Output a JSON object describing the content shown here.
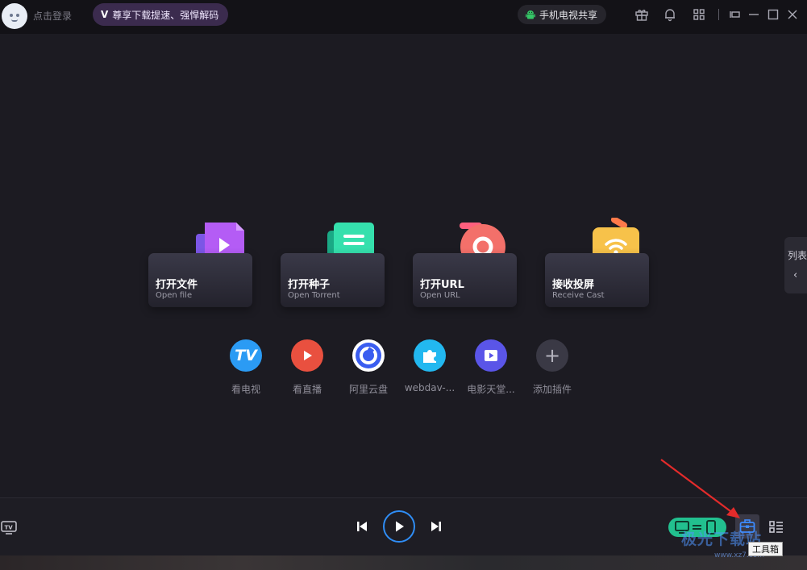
{
  "titlebar": {
    "login_label": "点击登录",
    "vip_label": "尊享下载提速、强悍解码",
    "share_label": "手机电视共享",
    "icons": [
      "gift-icon",
      "bell-icon",
      "apps-icon",
      "mini-mode-icon",
      "minimize-icon",
      "maximize-icon",
      "close-icon"
    ]
  },
  "cards": [
    {
      "title": "打开文件",
      "sub": "Open file",
      "color": "#a25cf3"
    },
    {
      "title": "打开种子",
      "sub": "Open Torrent",
      "color": "#2fd9a8"
    },
    {
      "title": "打开URL",
      "sub": "Open URL",
      "color": "#f36b6b"
    },
    {
      "title": "接收投屏",
      "sub": "Receive Cast",
      "color": "#f7c24a"
    }
  ],
  "plugins": [
    {
      "label": "看电视",
      "glyph": "TV",
      "color": "#2b9bf4"
    },
    {
      "label": "看直播",
      "glyph": "",
      "color": "#e9503f"
    },
    {
      "label": "阿里云盘",
      "glyph": "",
      "color": "#3a5df0"
    },
    {
      "label": "webdav-...",
      "glyph": "",
      "color": "#22b8f0"
    },
    {
      "label": "电影天堂...",
      "glyph": "",
      "color": "#5a55e8"
    },
    {
      "label": "添加插件",
      "glyph": "+",
      "color": "#3a3945"
    }
  ],
  "side_tab": {
    "label": "列表"
  },
  "bottom": {
    "tooltip": "工具箱",
    "watermark": "极光下载站",
    "watermark_sub": "www.xz7.com"
  },
  "colors": {
    "accent_blue": "#2f8df5",
    "cast_green": "#22c08f",
    "background": "#1c1b22"
  }
}
